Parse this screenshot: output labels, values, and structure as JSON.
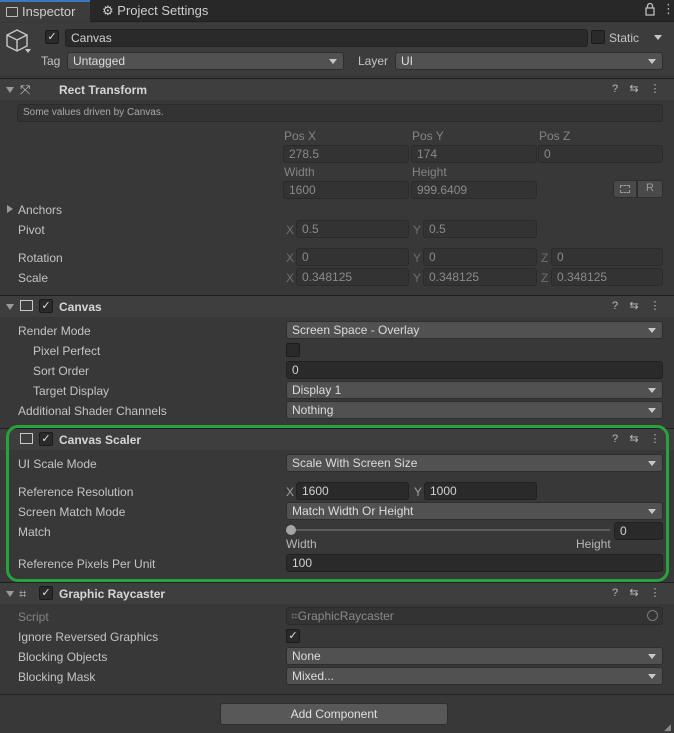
{
  "tabs": [
    {
      "label": "Inspector"
    },
    {
      "label": "Project Settings"
    }
  ],
  "gameobject": {
    "name": "Canvas",
    "static_label": "Static",
    "tag_label": "Tag",
    "tag_value": "Untagged",
    "layer_label": "Layer",
    "layer_value": "UI"
  },
  "rect_transform": {
    "title": "Rect Transform",
    "note": "Some values driven by Canvas.",
    "pos_x_label": "Pos X",
    "pos_y_label": "Pos Y",
    "pos_z_label": "Pos Z",
    "pos_x": "278.5",
    "pos_y": "174",
    "pos_z": "0",
    "width_label": "Width",
    "height_label": "Height",
    "width": "1600",
    "height": "999.6409",
    "r_button": "R",
    "anchors_label": "Anchors",
    "pivot_label": "Pivot",
    "pivot_x": "0.5",
    "pivot_y": "0.5",
    "rotation_label": "Rotation",
    "rot_x": "0",
    "rot_y": "0",
    "rot_z": "0",
    "scale_label": "Scale",
    "scale_x": "0.348125",
    "scale_y": "0.348125",
    "scale_z": "0.348125",
    "x": "X",
    "y": "Y",
    "z": "Z"
  },
  "canvas": {
    "title": "Canvas",
    "render_mode_label": "Render Mode",
    "render_mode": "Screen Space - Overlay",
    "pixel_perfect_label": "Pixel Perfect",
    "sort_order_label": "Sort Order",
    "sort_order": "0",
    "target_display_label": "Target Display",
    "target_display": "Display 1",
    "shader_channels_label": "Additional Shader Channels",
    "shader_channels": "Nothing"
  },
  "canvas_scaler": {
    "title": "Canvas Scaler",
    "ui_scale_mode_label": "UI Scale Mode",
    "ui_scale_mode": "Scale With Screen Size",
    "ref_res_label": "Reference Resolution",
    "ref_x": "1600",
    "ref_y": "1000",
    "match_mode_label": "Screen Match Mode",
    "match_mode": "Match Width Or Height",
    "match_label": "Match",
    "match_value": "0",
    "match_min_label": "Width",
    "match_max_label": "Height",
    "match_fraction": 0,
    "ref_ppu_label": "Reference Pixels Per Unit",
    "ref_ppu": "100",
    "highlight_color": "#27a33c"
  },
  "graphic_raycaster": {
    "title": "Graphic Raycaster",
    "script_label": "Script",
    "script_value": "GraphicRaycaster",
    "ignore_reversed_label": "Ignore Reversed Graphics",
    "blocking_objects_label": "Blocking Objects",
    "blocking_objects": "None",
    "blocking_mask_label": "Blocking Mask",
    "blocking_mask": "Mixed..."
  },
  "add_component_label": "Add Component",
  "icons": [
    "inspector-tab-icon",
    "settings-gear-icon",
    "lock-icon",
    "kebab-menu-icon",
    "cube-icon",
    "help-icon",
    "preset-icon"
  ]
}
